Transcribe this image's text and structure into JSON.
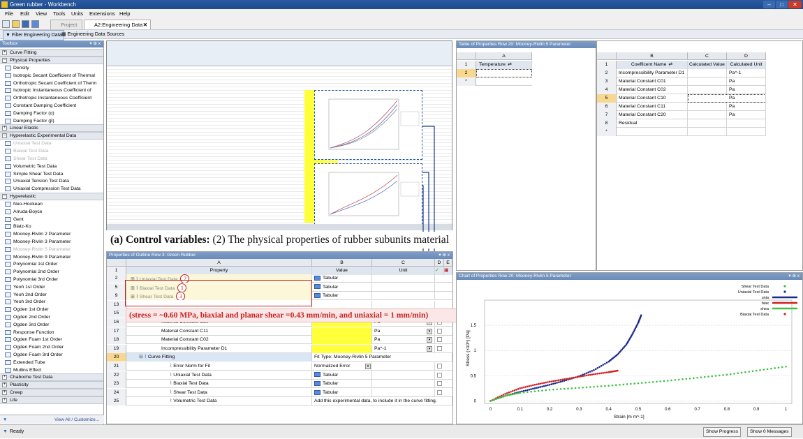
{
  "window": {
    "title": "Green rubber - Workbench",
    "min": "–",
    "max": "□",
    "close": "✕"
  },
  "menu": [
    "File",
    "Edit",
    "View",
    "Tools",
    "Units",
    "Extensions",
    "Help"
  ],
  "tabs": [
    {
      "label": "Project"
    },
    {
      "label": "A2:Engineering Data"
    }
  ],
  "subtoolbar": {
    "filter": "Filter Engineering Data",
    "sources": "Engineering Data Sources"
  },
  "toolbox": {
    "title": "Toolbox",
    "groups": [
      {
        "label": "Curve Fitting",
        "items": []
      },
      {
        "label": "Physical Properties",
        "items": [
          {
            "label": "Density"
          },
          {
            "label": "Isotropic Secant Coefficient of Thermal"
          },
          {
            "label": "Orthotropic Secant Coefficient of Therm"
          },
          {
            "label": "Isotropic Instantaneous Coefficient of"
          },
          {
            "label": "Orthotropic Instantaneous Coefficient"
          },
          {
            "label": "Constant Damping Coefficient"
          },
          {
            "label": "Damping Factor (α)"
          },
          {
            "label": "Damping Factor (β)"
          }
        ]
      },
      {
        "label": "Linear Elastic",
        "items": []
      },
      {
        "label": "Hyperelastic Experimental Data",
        "items": [
          {
            "label": "Uniaxial Test Data",
            "dim": true
          },
          {
            "label": "Biaxial Test Data",
            "dim": true
          },
          {
            "label": "Shear Test Data",
            "dim": true
          },
          {
            "label": "Volumetric Test Data"
          },
          {
            "label": "Simple Shear Test Data"
          },
          {
            "label": "Uniaxial Tension Test Data"
          },
          {
            "label": "Uniaxial Compression Test Data"
          }
        ]
      },
      {
        "label": "Hyperelastic",
        "items": [
          {
            "label": "Neo-Hookean"
          },
          {
            "label": "Arruda-Boyce"
          },
          {
            "label": "Gent"
          },
          {
            "label": "Blatz-Ko"
          },
          {
            "label": "Mooney-Rivlin 2 Parameter"
          },
          {
            "label": "Mooney-Rivlin 3 Parameter"
          },
          {
            "label": "Mooney-Rivlin 5 Parameter",
            "dim": true
          },
          {
            "label": "Mooney-Rivlin 9 Parameter"
          },
          {
            "label": "Polynomial 1st Order"
          },
          {
            "label": "Polynomial 2nd Order"
          },
          {
            "label": "Polynomial 3rd Order"
          },
          {
            "label": "Yeoh 1st Order"
          },
          {
            "label": "Yeoh 2nd Order"
          },
          {
            "label": "Yeoh 3rd Order"
          },
          {
            "label": "Ogden 1st Order"
          },
          {
            "label": "Ogden 2nd Order"
          },
          {
            "label": "Ogden 3rd Order"
          },
          {
            "label": "Response Function"
          },
          {
            "label": "Ogden Foam 1st Order"
          },
          {
            "label": "Ogden Foam 2nd Order"
          },
          {
            "label": "Ogden Foam 3rd Order"
          },
          {
            "label": "Extended Tube"
          },
          {
            "label": "Mullins Effect"
          }
        ]
      },
      {
        "label": "Chaboche Test Data",
        "items": []
      },
      {
        "label": "Plasticity",
        "items": []
      },
      {
        "label": "Creep",
        "items": []
      },
      {
        "label": "Life",
        "items": []
      }
    ],
    "footer": "View All / Customize..."
  },
  "caption": {
    "bold": "(a) Control variables:",
    "text": " (2) The physical properties of rubber subunits material"
  },
  "annotation": "(stress = ~0.60 MPa, biaxial and planar shear =0.43 mm/min, and uniaxial = 1 mm/min)",
  "outline": {
    "title": "Properties of Outline Row 3: Green Rubber",
    "cols": [
      "A",
      "B",
      "C",
      "D",
      "E"
    ],
    "headers": {
      "property": "Property",
      "value": "Value",
      "unit": "Unit"
    },
    "rows": [
      {
        "n": "2",
        "prop": "Uniaxial Test Data",
        "value": "Tabular",
        "unit": "",
        "marker": "2"
      },
      {
        "n": "5",
        "prop": "Biaxial Test Data",
        "value": "Tabular",
        "unit": "",
        "marker": "1"
      },
      {
        "n": "9",
        "prop": "Shear Test Data",
        "value": "Tabular",
        "unit": "",
        "marker": "3"
      },
      {
        "n": "13",
        "prop": "",
        "value": "",
        "unit": ""
      },
      {
        "n": "15",
        "prop": "Material Constant C01",
        "value": "",
        "unit": "Pa"
      },
      {
        "n": "16",
        "prop": "Material Constant C20",
        "value": "",
        "unit": "Pa"
      },
      {
        "n": "17",
        "prop": "Material Constant C11",
        "value": "",
        "unit": "Pa"
      },
      {
        "n": "18",
        "prop": "Material Constant C02",
        "value": "",
        "unit": "Pa"
      },
      {
        "n": "19",
        "prop": "Incompressibility Parameter D1",
        "value": "",
        "unit": "Pa^-1"
      },
      {
        "n": "20",
        "prop": "Curve Fitting",
        "value": "Fit Type: Mooney-Rivlin 5 Parameter",
        "unit": ""
      },
      {
        "n": "21",
        "prop": "Error Norm for Fit",
        "value": "Normalized Error",
        "unit": ""
      },
      {
        "n": "22",
        "prop": "Uniaxial Test Data",
        "value": "Tabular",
        "unit": ""
      },
      {
        "n": "23",
        "prop": "Biaxial Test Data",
        "value": "Tabular",
        "unit": ""
      },
      {
        "n": "24",
        "prop": "Shear Test Data",
        "value": "Tabular",
        "unit": ""
      },
      {
        "n": "25",
        "prop": "Volumetric Test Data",
        "value": "Add this experimental data, to include it in the curve fitting.",
        "unit": ""
      }
    ]
  },
  "table20": {
    "title": "Table of Properties Row 20: Mooney-Rivlin 5 Parameter",
    "left": {
      "col": "A",
      "header": "Temperature",
      "rows": [
        "1",
        "2",
        "*"
      ]
    },
    "right": {
      "cols": [
        "B",
        "C",
        "D"
      ],
      "headers": [
        "Coefficent Name",
        "Calculated Value",
        "Calculated Unit"
      ],
      "rows": [
        {
          "n": "2",
          "name": "Incompressibility Parameter D1",
          "val": "",
          "unit": "Pa^-1"
        },
        {
          "n": "3",
          "name": "Material Constant C01",
          "val": "",
          "unit": "Pa"
        },
        {
          "n": "4",
          "name": "Material Constant C02",
          "val": "",
          "unit": "Pa"
        },
        {
          "n": "5",
          "name": "Material Constant C10",
          "val": "",
          "unit": "Pa"
        },
        {
          "n": "6",
          "name": "Material Constant C11",
          "val": "",
          "unit": "Pa"
        },
        {
          "n": "7",
          "name": "Material Constant C20",
          "val": "",
          "unit": "Pa"
        },
        {
          "n": "8",
          "name": "Residual",
          "val": "",
          "unit": ""
        },
        {
          "n": "*",
          "name": "",
          "val": "",
          "unit": ""
        }
      ]
    }
  },
  "chart": {
    "title": "Chart of Properties Row 20: Mooney-Rivlin 5 Parameter"
  },
  "chart_data": {
    "type": "scatter",
    "xlabel": "Strain [m m^-1]",
    "ylabel": "Stress (×10⁶) [Pa]",
    "xlim": [
      -0.02,
      1.02
    ],
    "ylim": [
      -0.05,
      2.0
    ],
    "xticks": [
      0,
      0.1,
      0.2,
      0.3,
      0.4,
      0.5,
      0.6,
      0.7,
      0.8,
      0.9,
      1
    ],
    "yticks": [
      0,
      0.5,
      1,
      1.5
    ],
    "legend": [
      "Shear Test Data",
      "Uniaxial Test Data",
      "unia",
      "biax",
      "shea",
      "Biaxial Test Data"
    ],
    "series": [
      {
        "name": "Uniaxial Test Data",
        "color": "#1a2a8a",
        "points": [
          [
            0,
            0
          ],
          [
            0.05,
            0.1
          ],
          [
            0.1,
            0.18
          ],
          [
            0.15,
            0.25
          ],
          [
            0.2,
            0.32
          ],
          [
            0.25,
            0.4
          ],
          [
            0.3,
            0.49
          ],
          [
            0.35,
            0.61
          ],
          [
            0.4,
            0.78
          ],
          [
            0.43,
            0.92
          ],
          [
            0.46,
            1.12
          ],
          [
            0.48,
            1.32
          ],
          [
            0.5,
            1.55
          ],
          [
            0.51,
            1.7
          ]
        ]
      },
      {
        "name": "Biaxial Test Data",
        "color": "#d02020",
        "points": [
          [
            0,
            0
          ],
          [
            0.05,
            0.14
          ],
          [
            0.1,
            0.25
          ],
          [
            0.15,
            0.32
          ],
          [
            0.2,
            0.38
          ],
          [
            0.25,
            0.43
          ],
          [
            0.3,
            0.48
          ],
          [
            0.35,
            0.53
          ],
          [
            0.4,
            0.57
          ],
          [
            0.43,
            0.6
          ]
        ]
      },
      {
        "name": "Shear Test Data",
        "color": "#40c040",
        "points": [
          [
            0,
            0
          ],
          [
            0.05,
            0.1
          ],
          [
            0.1,
            0.16
          ],
          [
            0.2,
            0.22
          ],
          [
            0.3,
            0.26
          ],
          [
            0.4,
            0.3
          ],
          [
            0.5,
            0.35
          ],
          [
            0.6,
            0.4
          ],
          [
            0.7,
            0.46
          ],
          [
            0.8,
            0.52
          ],
          [
            0.9,
            0.6
          ],
          [
            1,
            0.68
          ]
        ]
      }
    ]
  },
  "status": {
    "ready": "Ready",
    "progress": "Show Progress",
    "messages": "Show 0 Messages"
  }
}
